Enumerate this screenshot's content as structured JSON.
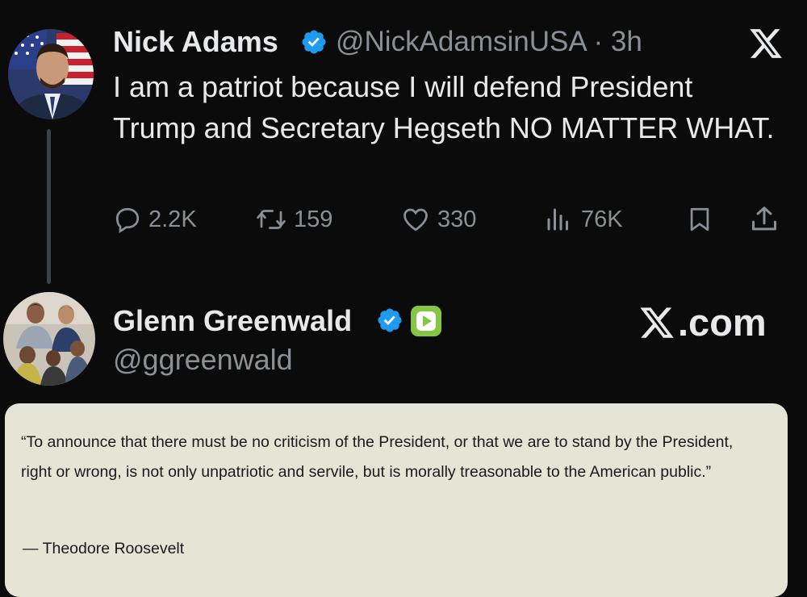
{
  "tweet1": {
    "author_name": "Nick Adams",
    "handle_time": "@NickAdamsinUSA · 3h",
    "text": "I am a patriot because I will defend President Trump and Secretary Hegseth NO MATTER WHAT.",
    "replies": "2.2K",
    "reposts": "159",
    "likes": "330",
    "views": "76K",
    "verified_color": "#1d9bf0"
  },
  "tweet2": {
    "author_name": "Glenn Greenwald",
    "handle": "@ggreenwald",
    "site_label": ".com",
    "verified_color": "#1d9bf0",
    "rumble_color": "#85c742"
  },
  "quote": {
    "text": "“To announce that there must be no criticism of the President, or that we are to stand by the President, right or wrong, is not only unpatriotic and servile, but is morally treasonable to the American public.”",
    "attribution": "— Theodore Roosevelt"
  },
  "icons": [
    "avatar",
    "verified-badge-icon",
    "x-logo-icon",
    "reply-icon",
    "repost-icon",
    "like-icon",
    "views-icon",
    "bookmark-icon",
    "share-icon",
    "rumble-icon"
  ]
}
